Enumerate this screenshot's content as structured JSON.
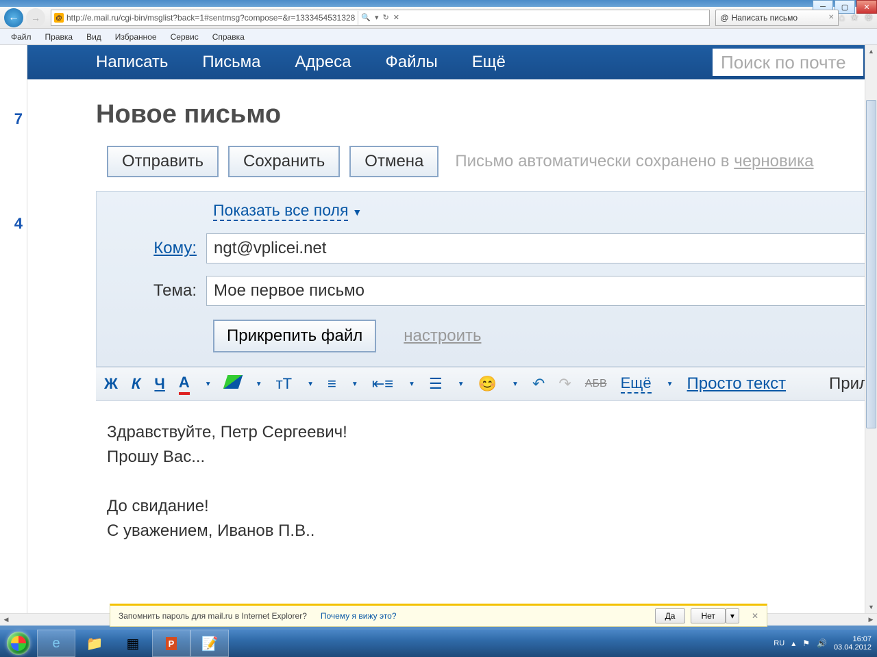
{
  "window": {
    "url": "http://e.mail.ru/cgi-bin/msglist?back=1#sentmsg?compose=&r=1333454531328",
    "tab_title": "Написать письмо"
  },
  "ie_menu": {
    "file": "Файл",
    "edit": "Правка",
    "view": "Вид",
    "fav": "Избранное",
    "tools": "Сервис",
    "help": "Справка"
  },
  "ruler": {
    "mark1": "7",
    "mark2": "4"
  },
  "mailnav": {
    "compose": "Написать",
    "inbox": "Письма",
    "contacts": "Адреса",
    "files": "Файлы",
    "more": "Ещё",
    "search_placeholder": "Поиск по почте"
  },
  "compose": {
    "title": "Новое письмо",
    "send": "Отправить",
    "save": "Сохранить",
    "cancel": "Отмена",
    "autosave_pre": "Письмо автоматически сохранено в ",
    "autosave_link": "черновика",
    "show_all": "Показать все поля",
    "to_label": "Кому:",
    "to_value": "ngt@vplicei.net",
    "subj_label": "Тема:",
    "subj_value": "Мое первое письмо",
    "attach": "Прикрепить файл",
    "attach_settings": "настроить"
  },
  "toolbar": {
    "bold": "Ж",
    "italic": "К",
    "under": "Ч",
    "color": "A",
    "size": "тТ",
    "strike": "АБВ",
    "more": "Ещё",
    "plain": "Просто текст",
    "right": "Прил"
  },
  "body": {
    "l1": "Здравствуйте, Петр Сергеевич!",
    "l2": "Прошу Вас...",
    "l3": "До свидание!",
    "l4": "С уважением, Иванов П.В.."
  },
  "notif": {
    "msg": "Запомнить пароль для mail.ru в Internet Explorer?",
    "why": "Почему я вижу это?",
    "yes": "Да",
    "no": "Нет"
  },
  "tray": {
    "lang": "RU",
    "time": "16:07",
    "date": "03.04.2012"
  }
}
